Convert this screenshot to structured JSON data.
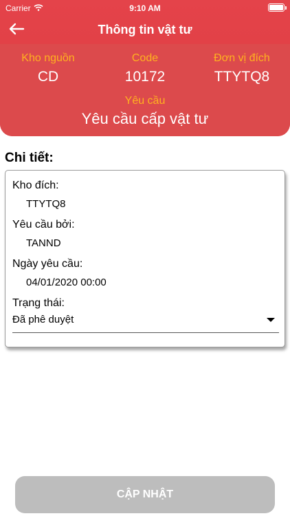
{
  "status_bar": {
    "carrier": "Carrier",
    "time": "9:10 AM"
  },
  "nav": {
    "title": "Thông tin vật tư"
  },
  "info": {
    "source_label": "Kho nguồn",
    "source_value": "CD",
    "code_label": "Code",
    "code_value": "10172",
    "dest_label": "Đơn vị đích",
    "dest_value": "TTYTQ8",
    "request_label": "Yêu cầu",
    "request_value": "Yêu cầu cấp vật tư"
  },
  "details": {
    "title": "Chi tiết:",
    "dest_warehouse_label": "Kho đích:",
    "dest_warehouse_value": "TTYTQ8",
    "requested_by_label": "Yêu cầu bởi:",
    "requested_by_value": "TANND",
    "request_date_label": "Ngày yêu cầu:",
    "request_date_value": "04/01/2020 00:00",
    "status_label": "Trạng thái:",
    "status_value": "Đã phê duyệt"
  },
  "actions": {
    "update_label": "CẬP NHẬT"
  },
  "colors": {
    "header": "#e0423f",
    "accent_label": "#ffb21f",
    "button_disabled": "#bdbdbd"
  }
}
